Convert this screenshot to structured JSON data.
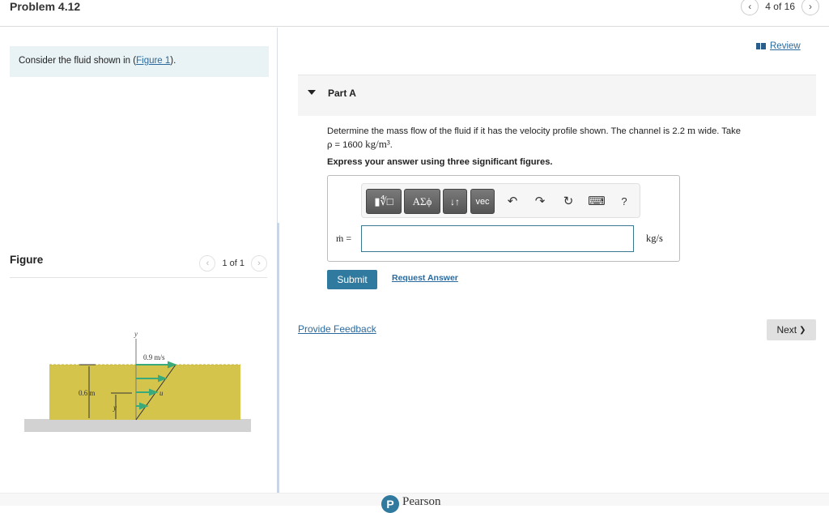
{
  "header": {
    "title": "Problem 4.12",
    "pager": {
      "prev_icon": "‹",
      "label": "4 of 16",
      "next_icon": "›"
    }
  },
  "left": {
    "intro_prefix": "Consider the fluid shown in (",
    "intro_link": "Figure 1",
    "intro_suffix": ").",
    "figure": {
      "title": "Figure",
      "pager": "1 of 1",
      "labels": {
        "y_axis": "y",
        "velocity": "0.9 m/s",
        "depth": "0.6 m",
        "u": "u",
        "y_var": "y"
      },
      "colors": {
        "fluid": "#d4c44c",
        "arrows": "#3aaa7a",
        "ground": "#cfcfcf"
      }
    }
  },
  "review": {
    "label": "Review"
  },
  "part": {
    "label": "Part A",
    "question_text": "Determine the mass flow of the fluid if it has the velocity profile shown. The channel is 2.2",
    "question_unit": "m",
    "question_tail": "wide. Take",
    "rho_prefix": "ρ = 1600",
    "rho_unit": "kg/m³",
    "rho_suffix": ".",
    "instruction": "Express your answer using three significant figures.",
    "toolbar": {
      "templates": "▮∜□",
      "greek": "ΑΣϕ",
      "arrows": "↓↑",
      "vec": "vec",
      "undo": "↶",
      "redo": "↷",
      "reset": "↻",
      "keyboard": "⌨",
      "help": "?"
    },
    "answer_label": "ṁ =",
    "answer_value": "",
    "answer_units": "kg/s",
    "submit": "Submit",
    "request_answer": "Request Answer"
  },
  "feedback": "Provide Feedback",
  "next": {
    "label": "Next",
    "icon": "❯"
  },
  "footer": {
    "brand": "Pearson",
    "logo": "P"
  },
  "colors": {
    "accent": "#2f7a9e",
    "link": "#2a6a9e",
    "intro_bg": "#e9f3f6"
  }
}
